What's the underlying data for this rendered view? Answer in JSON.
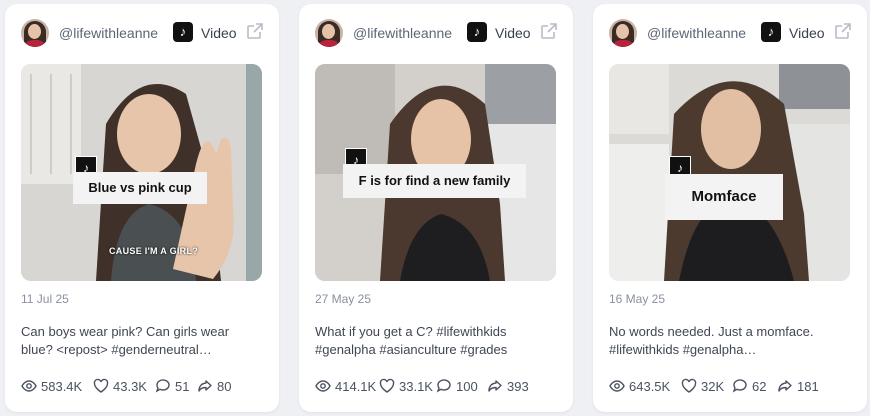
{
  "cards": [
    {
      "handle": "@lifewithleanne",
      "type": "Video",
      "overlay_text": "Blue vs pink cup",
      "subtitle": "CAUSE I'M A GIRL?",
      "date": "11 Jul 25",
      "caption": "Can boys wear pink? Can girls wear blue? <repost> #genderneutral…",
      "views": "583.4K",
      "likes": "43.3K",
      "comments": "51",
      "shares": "80"
    },
    {
      "handle": "@lifewithleanne",
      "type": "Video",
      "overlay_text": "F is for find a new family",
      "date": "27 May 25",
      "caption": "What if you get a C? #lifewithkids #genalpha #asianculture #grades",
      "views": "414.1K",
      "likes": "33.1K",
      "comments": "100",
      "shares": "393"
    },
    {
      "handle": "@lifewithleanne",
      "type": "Video",
      "overlay_text": "Momface",
      "date": "16 May 25",
      "caption": "No words needed. Just a momface. #lifewithkids #genalpha…",
      "views": "643.5K",
      "likes": "32K",
      "comments": "62",
      "shares": "181"
    }
  ],
  "icons": {
    "platform": "tiktok-icon",
    "external": "external-link-icon",
    "views": "eye-icon",
    "likes": "heart-icon",
    "comments": "comment-icon",
    "shares": "share-icon"
  },
  "colors": {
    "card_bg": "#ffffff",
    "page_bg": "#eef0f4",
    "muted_text": "#8a90a0"
  }
}
